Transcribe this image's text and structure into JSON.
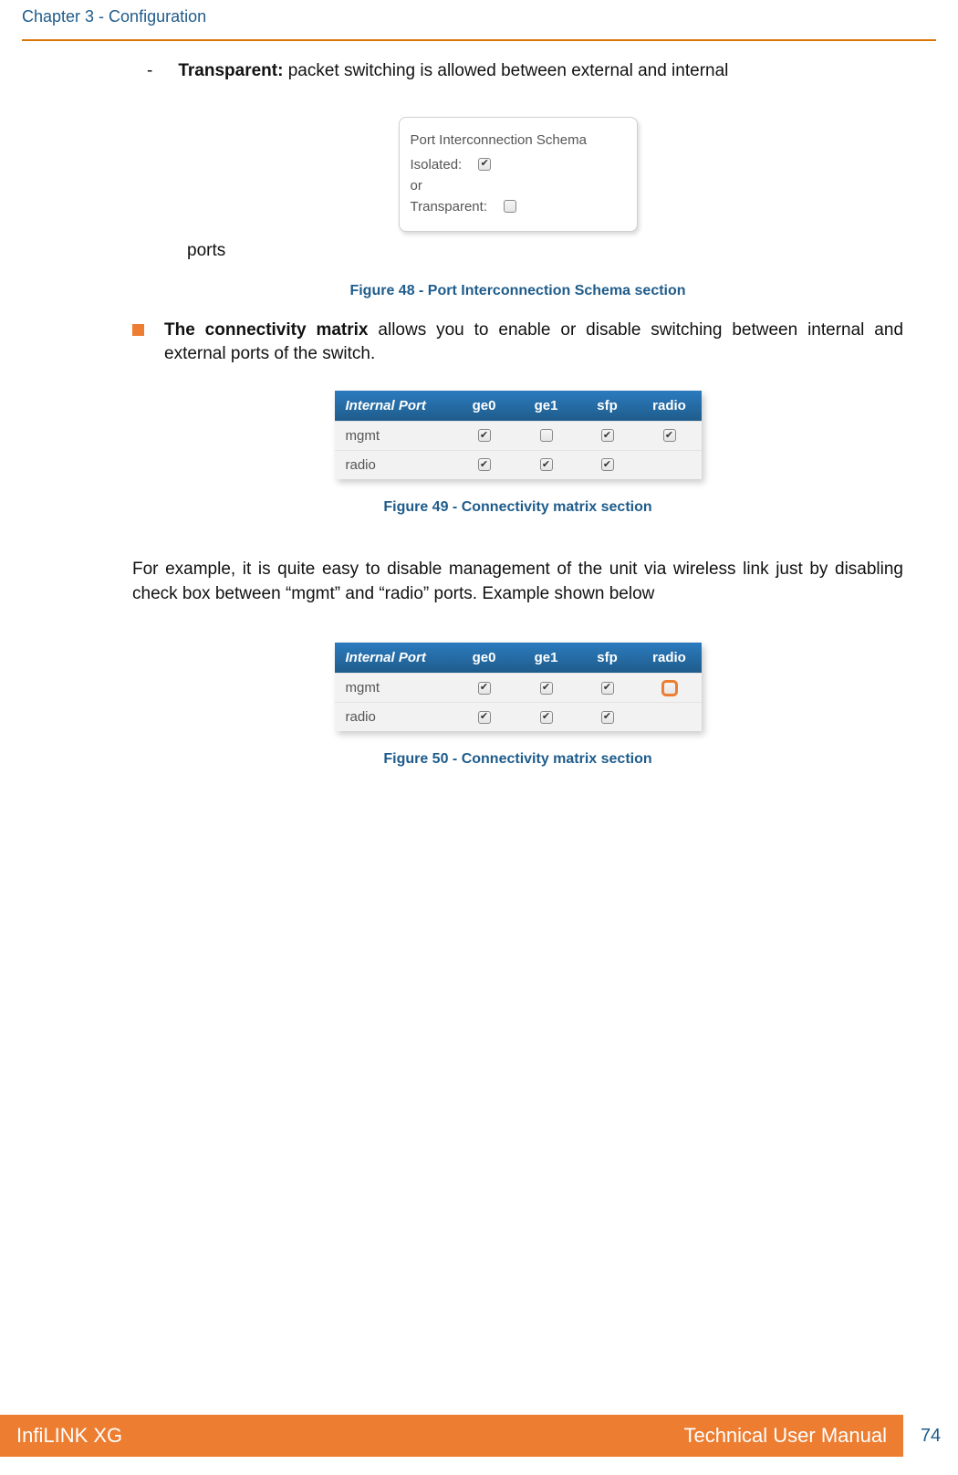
{
  "header": {
    "chapter": "Chapter 3 - Configuration"
  },
  "body": {
    "bullet1_label": "Transparent:",
    "bullet1_text": " packet switching is allowed between external and internal",
    "dash": "-",
    "ports_word": "ports"
  },
  "fig48": {
    "title": "Port Interconnection Schema",
    "isolated_label": "Isolated:",
    "isolated_check": "✔",
    "or_label": "or",
    "transparent_label": "Transparent:",
    "caption": "Figure 48 - Port Interconnection Schema section"
  },
  "bullet2": {
    "bold": "The connectivity matrix",
    "rest": " allows you to enable or disable switching between internal and external ports of the switch."
  },
  "matrix": {
    "headers": {
      "internal": "Internal Port",
      "ge0": "ge0",
      "ge1": "ge1",
      "sfp": "sfp",
      "radio": "radio"
    },
    "rows49": [
      {
        "name": "mgmt",
        "ge0": "✔",
        "ge1": "",
        "sfp": "✔",
        "radio": "✔"
      },
      {
        "name": "radio",
        "ge0": "✔",
        "ge1": "✔",
        "sfp": "✔",
        "radio": ""
      }
    ],
    "caption49": "Figure 49 - Connectivity matrix section",
    "rows50": [
      {
        "name": "mgmt",
        "ge0": "✔",
        "ge1": "✔",
        "sfp": "✔",
        "radio": ""
      },
      {
        "name": "radio",
        "ge0": "✔",
        "ge1": "✔",
        "sfp": "✔",
        "radio": ""
      }
    ],
    "caption50": "Figure 50 - Connectivity matrix section"
  },
  "para": "For example, it is quite easy to disable management of the unit via wireless link just by disabling check box between “mgmt” and “radio” ports. Example shown below",
  "footer": {
    "left": "InfiLINK XG",
    "right": "Technical User Manual",
    "page": "74"
  }
}
